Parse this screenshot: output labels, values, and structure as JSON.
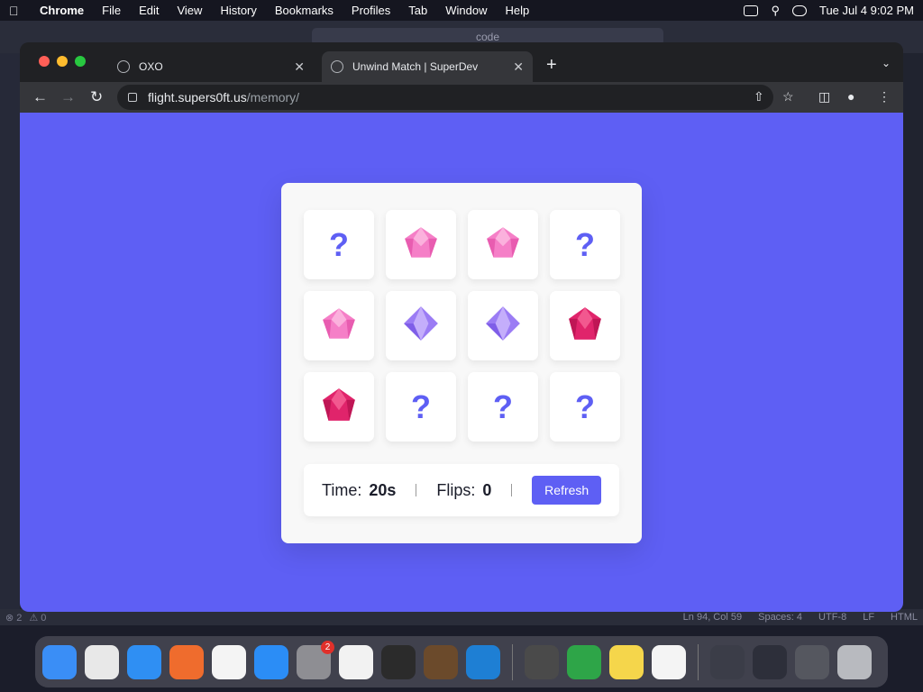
{
  "menubar": {
    "app": "Chrome",
    "items": [
      "File",
      "Edit",
      "View",
      "History",
      "Bookmarks",
      "Profiles",
      "Tab",
      "Window",
      "Help"
    ],
    "clock": "Tue Jul 4  9:02 PM"
  },
  "editor": {
    "search_text": "code",
    "status_left": [
      "⊗ 2",
      "⚠ 0"
    ],
    "status_right": [
      "Ln 94, Col 59",
      "Spaces: 4",
      "UTF-8",
      "LF",
      "HTML"
    ]
  },
  "browser": {
    "tabs": [
      {
        "label": "OXO",
        "active": false
      },
      {
        "label": "Unwind Match | SuperDev",
        "active": true
      }
    ],
    "url_host": "flight.supers0ft.us",
    "url_path": "/memory/"
  },
  "game": {
    "cards": [
      "?",
      "gem-pink",
      "gem-pink",
      "?",
      "gem-pink",
      "gem-purple",
      "gem-purple",
      "gem-red",
      "gem-red",
      "?",
      "?",
      "?"
    ],
    "card_order_note": "",
    "time_label": "Time:",
    "time_value": "20s",
    "flips_label": "Flips:",
    "flips_value": "0",
    "refresh_label": "Refresh"
  },
  "dock": {
    "apps": [
      {
        "name": "finder",
        "color": "#3a8ef6"
      },
      {
        "name": "launchpad",
        "color": "#e8e8e8"
      },
      {
        "name": "safari",
        "color": "#2f8ff3"
      },
      {
        "name": "firefox",
        "color": "#ef6c2d"
      },
      {
        "name": "chrome",
        "color": "#f4f4f4"
      },
      {
        "name": "app-store",
        "color": "#2b8df6"
      },
      {
        "name": "system-settings",
        "color": "#8e8e93",
        "badge": "2"
      },
      {
        "name": "textedit",
        "color": "#f2f2f2"
      },
      {
        "name": "terminal",
        "color": "#2b2b2b"
      },
      {
        "name": "garageband",
        "color": "#6b4a2b"
      },
      {
        "name": "vscode",
        "color": "#1e7fd4"
      },
      {
        "name": "calculator",
        "color": "#4a4a4a"
      },
      {
        "name": "numbers",
        "color": "#2ea548"
      },
      {
        "name": "notes",
        "color": "#f5d64b"
      },
      {
        "name": "chrome-2",
        "color": "#f4f4f4"
      },
      {
        "name": "window-1",
        "color": "#3b3d48"
      },
      {
        "name": "window-2",
        "color": "#2d2f3a"
      },
      {
        "name": "window-3",
        "color": "#55575f"
      },
      {
        "name": "trash",
        "color": "#b8babf"
      }
    ]
  }
}
